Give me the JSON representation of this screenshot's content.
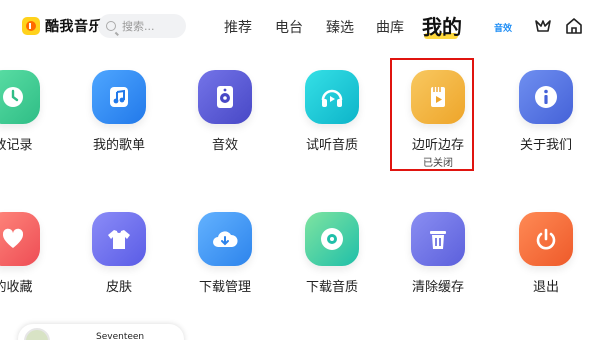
{
  "header": {
    "app_name": "酷我音乐",
    "search_placeholder": "搜索...",
    "tabs": [
      {
        "label": "推荐"
      },
      {
        "label": "电台"
      },
      {
        "label": "臻选"
      },
      {
        "label": "曲库"
      },
      {
        "label": "我的",
        "active": true
      }
    ],
    "sound_effect_badge": "音效",
    "icons": [
      "app-logo-icon",
      "search-icon",
      "vip-icon",
      "home-icon"
    ]
  },
  "grid": {
    "row1": [
      {
        "label": "放记录",
        "icon": "clock-icon",
        "color": "#3dcc8e"
      },
      {
        "label": "我的歌单",
        "icon": "music-note-icon",
        "color": "#2f8cf5"
      },
      {
        "label": "音效",
        "icon": "speaker-icon",
        "color": "#5b5bd6"
      },
      {
        "label": "试听音质",
        "icon": "headphones-icon",
        "color": "#16c4ce"
      },
      {
        "label": "边听边存",
        "sub": "已关闭",
        "icon": "save-while-listening-icon",
        "color": "#f3b43a"
      },
      {
        "label": "关于我们",
        "icon": "info-icon",
        "color": "#5577e6"
      }
    ],
    "row2": [
      {
        "label": "的收藏",
        "icon": "heart-icon",
        "color": "#f2645f"
      },
      {
        "label": "皮肤",
        "icon": "tshirt-icon",
        "color": "#6d6ff0"
      },
      {
        "label": "下载管理",
        "icon": "cloud-download-icon",
        "color": "#3f93f3"
      },
      {
        "label": "下载音质",
        "icon": "disc-icon",
        "color": "#33c9a3"
      },
      {
        "label": "清除缓存",
        "icon": "trash-icon",
        "color": "#6d72e8"
      },
      {
        "label": "退出",
        "icon": "power-icon",
        "color": "#f56a3c"
      }
    ]
  },
  "mini_player": {
    "title": "Seventeen"
  },
  "colors": {
    "highlight": "#e0140f",
    "accent": "#ffd21c",
    "badge": "#1f8ef5"
  }
}
